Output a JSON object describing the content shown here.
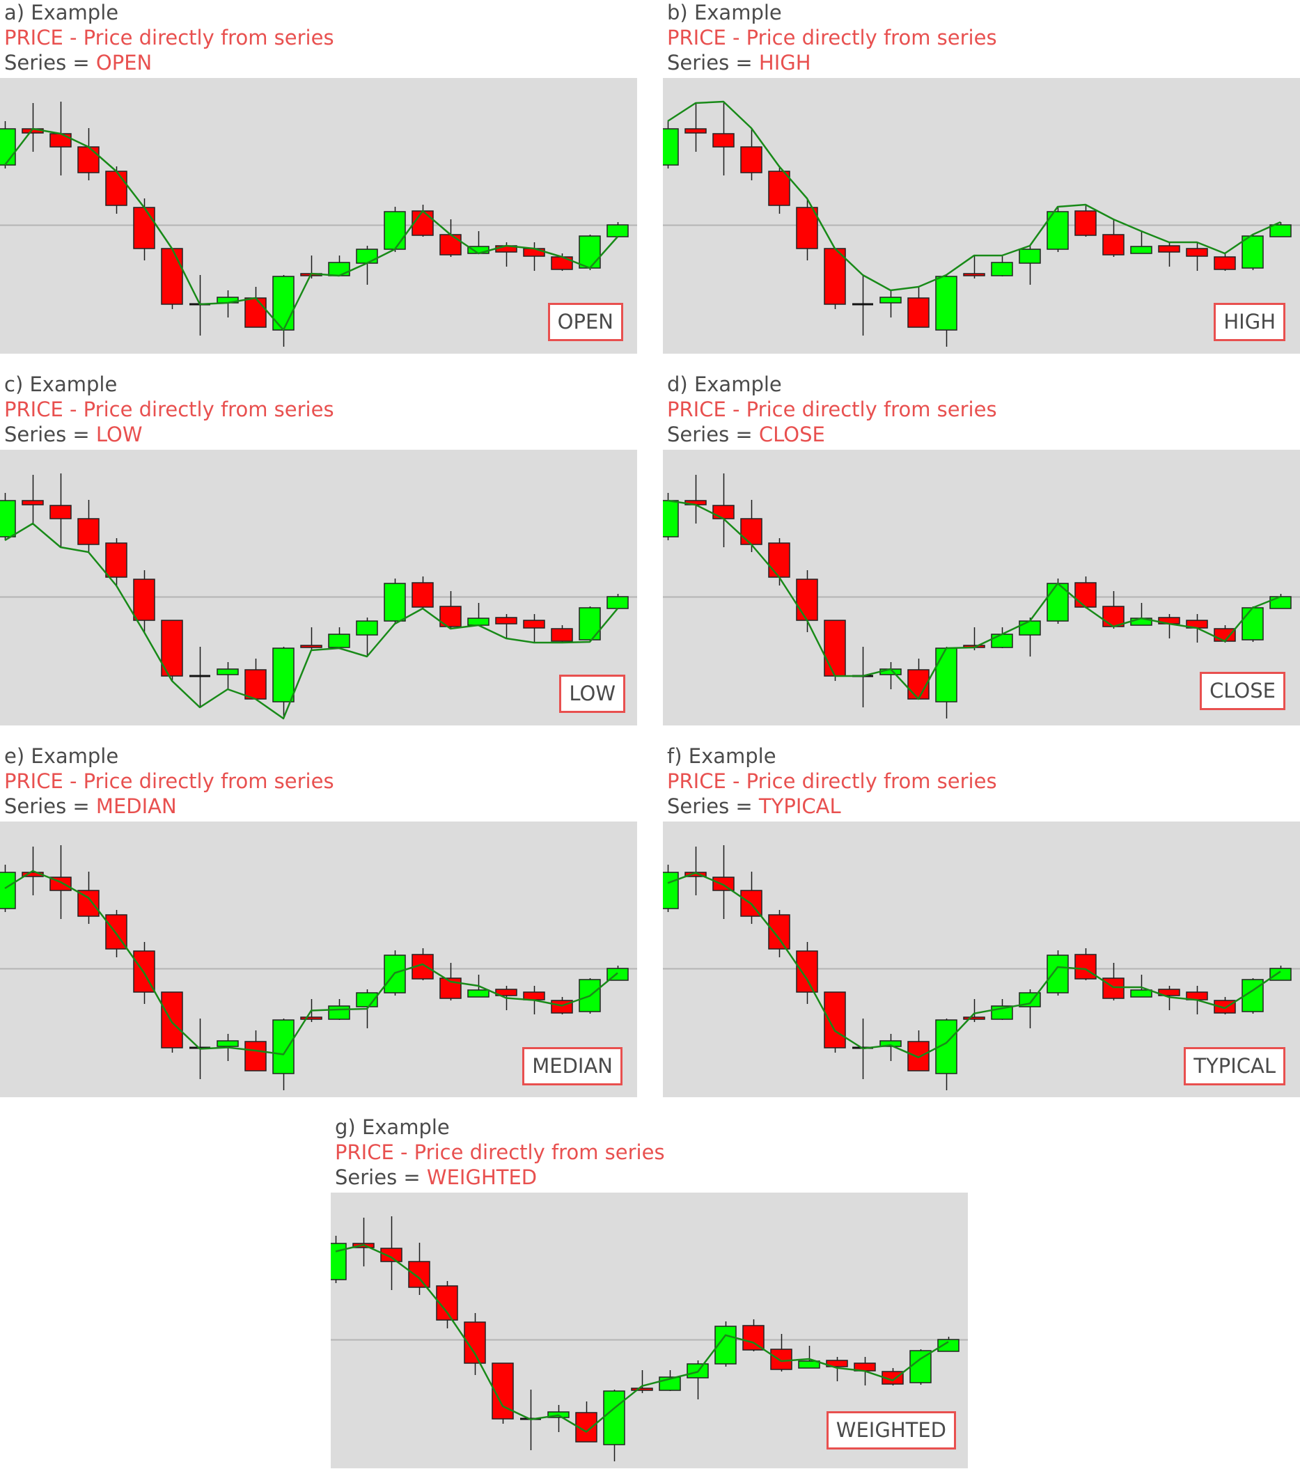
{
  "colors": {
    "panel_bg": "#dcdcdc",
    "bull": "#00ff00",
    "bear": "#ff0000",
    "doji": "#111111",
    "outline": "#222222",
    "line": "#188a18",
    "ref_line": "#b4b4b4",
    "accent": "#e8504f",
    "text": "#4a4a4a"
  },
  "panels": [
    {
      "title": "a) Example",
      "method": "PRICE - Price directly from series",
      "series_prefix": "Series = ",
      "series": "OPEN",
      "tag": "OPEN"
    },
    {
      "title": "b) Example",
      "method": "PRICE - Price directly from series",
      "series_prefix": "Series = ",
      "series": "HIGH",
      "tag": "HIGH"
    },
    {
      "title": "c) Example",
      "method": "PRICE - Price directly from series",
      "series_prefix": "Series = ",
      "series": "LOW",
      "tag": "LOW"
    },
    {
      "title": "d) Example",
      "method": "PRICE - Price directly from series",
      "series_prefix": "Series = ",
      "series": "CLOSE",
      "tag": "CLOSE"
    },
    {
      "title": "e) Example",
      "method": "PRICE - Price directly from series",
      "series_prefix": "Series = ",
      "series": "MEDIAN",
      "tag": "MEDIAN"
    },
    {
      "title": "f) Example",
      "method": "PRICE - Price directly from series",
      "series_prefix": "Series = ",
      "series": "TYPICAL",
      "tag": "TYPICAL"
    },
    {
      "title": "g) Example",
      "method": "PRICE - Price directly from series",
      "series_prefix": "Series = ",
      "series": "WEIGHTED",
      "tag": "WEIGHTED"
    }
  ],
  "chart_data": {
    "type": "candlestick",
    "title": "PRICE - Price directly from series",
    "xlabel": "",
    "ylabel": "",
    "ylim": [
      0,
      99
    ],
    "grid": false,
    "reference_level": 46.25,
    "series_formulas": {
      "OPEN": "open",
      "HIGH": "high",
      "LOW": "low",
      "CLOSE": "close",
      "MEDIAN": "(high+low)/2",
      "TYPICAL": "(high+low+close)/3",
      "WEIGHTED": "(high+low+2*close)/4"
    },
    "ohlc": [
      {
        "o": 67.75,
        "h": 83.5,
        "l": 66.5,
        "c": 80.75
      },
      {
        "o": 80.75,
        "h": 90.0,
        "l": 72.5,
        "c": 79.25
      },
      {
        "o": 79.0,
        "h": 90.5,
        "l": 64.0,
        "c": 74.25
      },
      {
        "o": 74.25,
        "h": 81.0,
        "l": 62.25,
        "c": 65.0
      },
      {
        "o": 65.5,
        "h": 67.25,
        "l": 50.25,
        "c": 53.25
      },
      {
        "o": 52.5,
        "h": 55.75,
        "l": 33.5,
        "c": 37.75
      },
      {
        "o": 37.75,
        "h": 37.75,
        "l": 16.0,
        "c": 17.75
      },
      {
        "o": 17.75,
        "h": 28.25,
        "l": 6.5,
        "c": 17.75
      },
      {
        "o": 18.25,
        "h": 22.75,
        "l": 13.0,
        "c": 20.25
      },
      {
        "o": 20.0,
        "h": 24.0,
        "l": 9.5,
        "c": 9.5
      },
      {
        "o": 8.5,
        "h": 28.25,
        "l": 2.5,
        "c": 27.75
      },
      {
        "o": 28.75,
        "h": 35.25,
        "l": 27.0,
        "c": 28.0
      },
      {
        "o": 28.0,
        "h": 35.25,
        "l": 27.75,
        "c": 32.75
      },
      {
        "o": 32.5,
        "h": 38.75,
        "l": 24.75,
        "c": 37.5
      },
      {
        "o": 37.5,
        "h": 52.75,
        "l": 36.5,
        "c": 51.0
      },
      {
        "o": 51.25,
        "h": 53.5,
        "l": 42.0,
        "c": 42.5
      },
      {
        "o": 42.75,
        "h": 48.25,
        "l": 34.75,
        "c": 35.5
      },
      {
        "o": 36.0,
        "h": 44.0,
        "l": 36.0,
        "c": 38.5
      },
      {
        "o": 38.75,
        "h": 40.0,
        "l": 31.25,
        "c": 36.5
      },
      {
        "o": 37.75,
        "h": 40.0,
        "l": 29.75,
        "c": 35.0
      },
      {
        "o": 34.75,
        "h": 36.0,
        "l": 29.75,
        "c": 30.25
      },
      {
        "o": 30.75,
        "h": 42.75,
        "l": 30.0,
        "c": 42.25
      },
      {
        "o": 42.0,
        "h": 47.25,
        "l": 42.0,
        "c": 46.25
      }
    ]
  }
}
